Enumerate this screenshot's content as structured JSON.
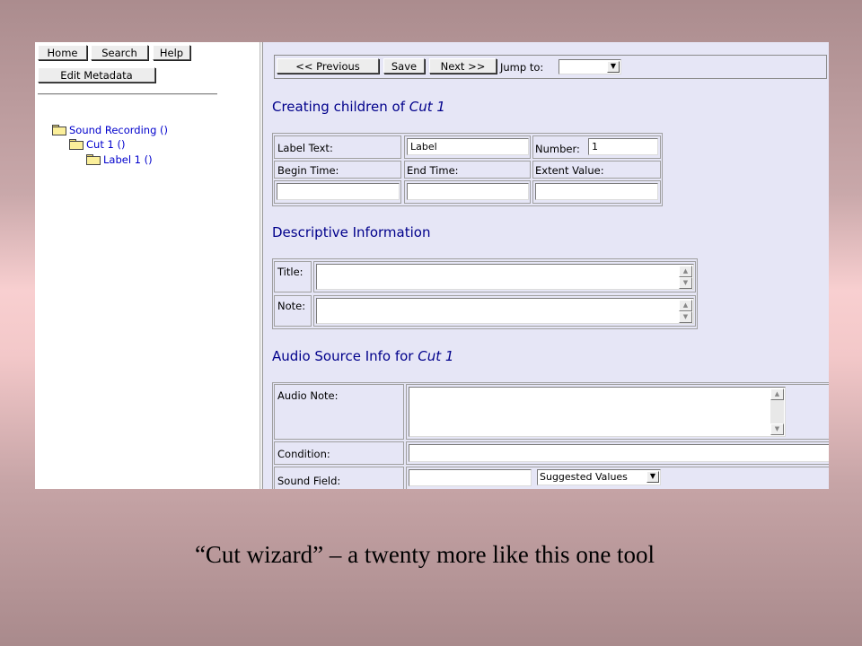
{
  "left": {
    "buttons": {
      "home": "Home",
      "search": "Search",
      "help": "Help",
      "edit_metadata": "Edit Metadata"
    },
    "tree": [
      {
        "label": "Sound Recording ()"
      },
      {
        "label": "Cut 1 ()"
      },
      {
        "label": "Label 1 ()"
      }
    ]
  },
  "toolbar": {
    "previous": "<< Previous",
    "save": "Save",
    "next": "Next >>",
    "jump_to_label": "Jump to:",
    "jump_to_value": ""
  },
  "children_section": {
    "heading_prefix": "Creating children of ",
    "heading_emph": "Cut 1",
    "label_text_label": "Label Text:",
    "label_text_value": "Label",
    "number_label": "Number:",
    "number_value": "1",
    "begin_time_label": "Begin Time:",
    "begin_time_value": "",
    "end_time_label": "End Time:",
    "end_time_value": "",
    "extent_value_label": "Extent Value:",
    "extent_value_value": ""
  },
  "descriptive_section": {
    "heading": "Descriptive Information",
    "title_label": "Title:",
    "title_value": "",
    "note_label": "Note:",
    "note_value": ""
  },
  "audio_section": {
    "heading_prefix": "Audio Source Info for ",
    "heading_emph": "Cut 1",
    "audio_note_label": "Audio Note:",
    "audio_note_value": "",
    "condition_label": "Condition:",
    "condition_value": "",
    "sound_field_label": "Sound Field:",
    "sound_field_value": "",
    "suggested_values": "Suggested Values"
  },
  "caption": "“Cut wizard” – a twenty more like this one tool"
}
